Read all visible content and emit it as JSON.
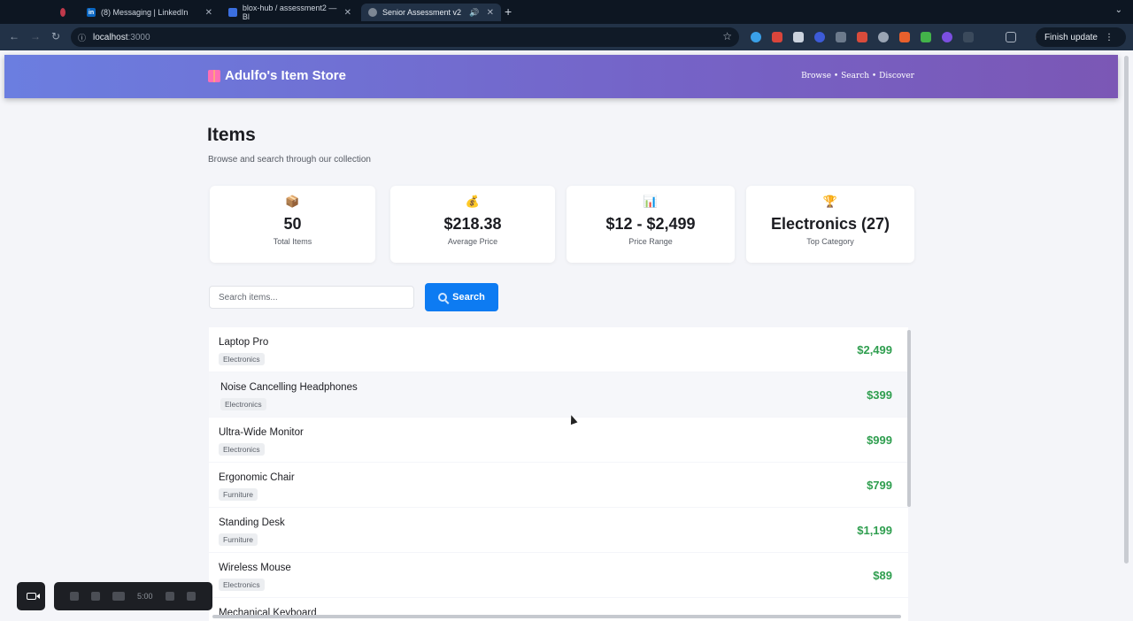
{
  "browser": {
    "tabs": [
      {
        "label": ""
      },
      {
        "label": "(8) Messaging | LinkedIn"
      },
      {
        "label": "blox-hub / assessment2 — Bl"
      },
      {
        "label": "Senior Assessment v2"
      }
    ],
    "url_host": "localhost",
    "url_port": ":3000",
    "finish_update": "Finish update"
  },
  "header": {
    "brand": "Adulfo's Item Store",
    "tagline": "Browse • Search • Discover"
  },
  "page": {
    "title": "Items",
    "subtitle": "Browse and search through our collection"
  },
  "stats": [
    {
      "icon": "box-icon",
      "glyph": "📦",
      "value": "50",
      "label": "Total Items"
    },
    {
      "icon": "money-bag-icon",
      "glyph": "💰",
      "value": "$218.38",
      "label": "Average Price"
    },
    {
      "icon": "bar-chart-icon",
      "glyph": "📊",
      "value": "$12 - $2,499",
      "label": "Price Range"
    },
    {
      "icon": "trophy-icon",
      "glyph": "🏆",
      "value": "Electronics (27)",
      "label": "Top Category"
    }
  ],
  "search": {
    "placeholder": "Search items...",
    "button_label": "Search"
  },
  "items": [
    {
      "name": "Laptop Pro",
      "category": "Electronics",
      "price": "$2,499"
    },
    {
      "name": "Noise Cancelling Headphones",
      "category": "Electronics",
      "price": "$399"
    },
    {
      "name": "Ultra-Wide Monitor",
      "category": "Electronics",
      "price": "$999"
    },
    {
      "name": "Ergonomic Chair",
      "category": "Furniture",
      "price": "$799"
    },
    {
      "name": "Standing Desk",
      "category": "Furniture",
      "price": "$1,199"
    },
    {
      "name": "Wireless Mouse",
      "category": "Electronics",
      "price": "$89"
    },
    {
      "name": "Mechanical Keyboard",
      "category": "",
      "price": ""
    }
  ],
  "recorder": {
    "time": "5:00"
  },
  "colors": {
    "accent": "#0d7bf2",
    "price": "#2f9e4f",
    "header_start": "#6b7ee0",
    "header_end": "#7b57b5"
  }
}
